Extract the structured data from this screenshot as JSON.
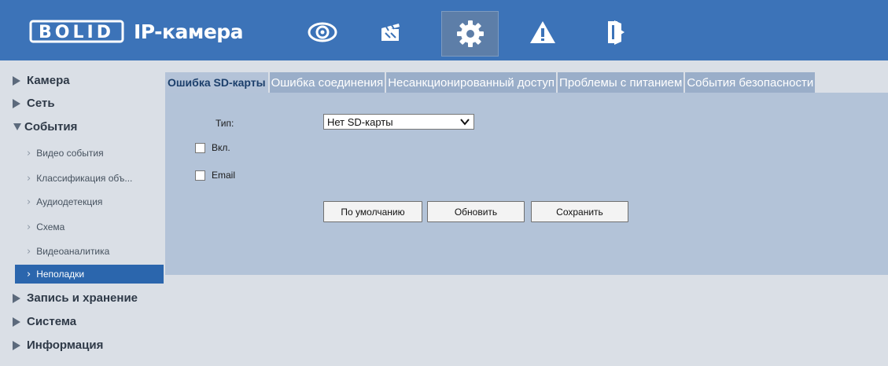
{
  "header": {
    "brand": "BOLID",
    "title": "IP-камера",
    "nav_icons": [
      "eye-icon",
      "clapper-icon",
      "gear-icon",
      "warning-icon",
      "exit-icon"
    ],
    "active_nav": "gear-icon"
  },
  "sidebar": {
    "camera": "Камера",
    "network": "Сеть",
    "events": "События",
    "sub": {
      "video_events": "Видео события",
      "object_classification": "Классификация объ...",
      "audio_detection": "Аудиодетекция",
      "schema": "Схема",
      "video_analytics": "Видеоаналитика",
      "faults": "Неполадки"
    },
    "recording": "Запись и хранение",
    "system": "Система",
    "info": "Информация"
  },
  "tabs": {
    "sd_error": "Ошибка SD-карты",
    "connection_error": "Ошибка соединения",
    "unauthorized": "Несанкционированный доступ",
    "power": "Проблемы с питанием",
    "security": "События безопасности"
  },
  "form": {
    "type_label": "Тип:",
    "type_value": "Нет SD-карты",
    "enable_label": "Вкл.",
    "email_label": "Email"
  },
  "buttons": {
    "default": "По умолчанию",
    "refresh": "Обновить",
    "save": "Сохранить"
  },
  "colors": {
    "header": "#3c73b8",
    "accent": "#2b66ad",
    "panel": "#b3c3d8",
    "tab": "#9aaec9"
  }
}
